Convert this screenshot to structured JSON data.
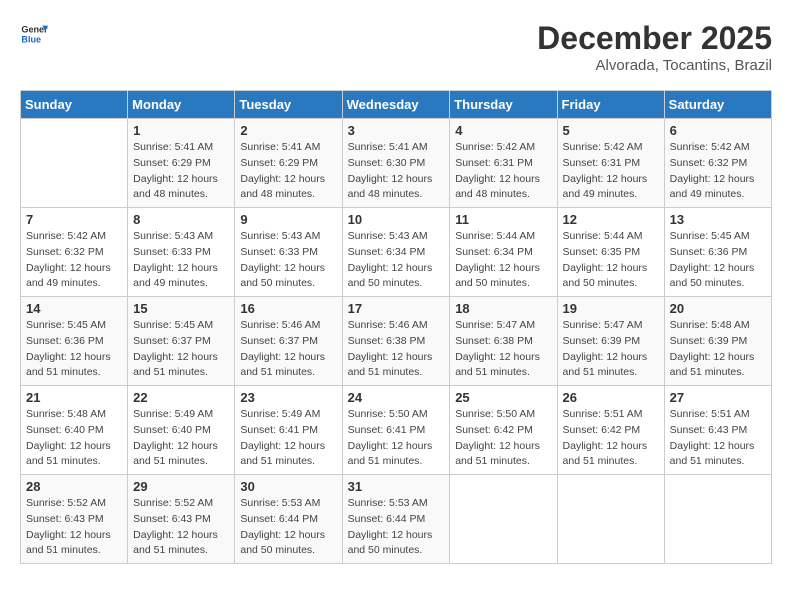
{
  "logo": {
    "line1": "General",
    "line2": "Blue"
  },
  "title": "December 2025",
  "subtitle": "Alvorada, Tocantins, Brazil",
  "days_header": [
    "Sunday",
    "Monday",
    "Tuesday",
    "Wednesday",
    "Thursday",
    "Friday",
    "Saturday"
  ],
  "weeks": [
    [
      {
        "day": "",
        "info": ""
      },
      {
        "day": "1",
        "info": "Sunrise: 5:41 AM\nSunset: 6:29 PM\nDaylight: 12 hours\nand 48 minutes."
      },
      {
        "day": "2",
        "info": "Sunrise: 5:41 AM\nSunset: 6:29 PM\nDaylight: 12 hours\nand 48 minutes."
      },
      {
        "day": "3",
        "info": "Sunrise: 5:41 AM\nSunset: 6:30 PM\nDaylight: 12 hours\nand 48 minutes."
      },
      {
        "day": "4",
        "info": "Sunrise: 5:42 AM\nSunset: 6:31 PM\nDaylight: 12 hours\nand 48 minutes."
      },
      {
        "day": "5",
        "info": "Sunrise: 5:42 AM\nSunset: 6:31 PM\nDaylight: 12 hours\nand 49 minutes."
      },
      {
        "day": "6",
        "info": "Sunrise: 5:42 AM\nSunset: 6:32 PM\nDaylight: 12 hours\nand 49 minutes."
      }
    ],
    [
      {
        "day": "7",
        "info": "Sunrise: 5:42 AM\nSunset: 6:32 PM\nDaylight: 12 hours\nand 49 minutes."
      },
      {
        "day": "8",
        "info": "Sunrise: 5:43 AM\nSunset: 6:33 PM\nDaylight: 12 hours\nand 49 minutes."
      },
      {
        "day": "9",
        "info": "Sunrise: 5:43 AM\nSunset: 6:33 PM\nDaylight: 12 hours\nand 50 minutes."
      },
      {
        "day": "10",
        "info": "Sunrise: 5:43 AM\nSunset: 6:34 PM\nDaylight: 12 hours\nand 50 minutes."
      },
      {
        "day": "11",
        "info": "Sunrise: 5:44 AM\nSunset: 6:34 PM\nDaylight: 12 hours\nand 50 minutes."
      },
      {
        "day": "12",
        "info": "Sunrise: 5:44 AM\nSunset: 6:35 PM\nDaylight: 12 hours\nand 50 minutes."
      },
      {
        "day": "13",
        "info": "Sunrise: 5:45 AM\nSunset: 6:36 PM\nDaylight: 12 hours\nand 50 minutes."
      }
    ],
    [
      {
        "day": "14",
        "info": "Sunrise: 5:45 AM\nSunset: 6:36 PM\nDaylight: 12 hours\nand 51 minutes."
      },
      {
        "day": "15",
        "info": "Sunrise: 5:45 AM\nSunset: 6:37 PM\nDaylight: 12 hours\nand 51 minutes."
      },
      {
        "day": "16",
        "info": "Sunrise: 5:46 AM\nSunset: 6:37 PM\nDaylight: 12 hours\nand 51 minutes."
      },
      {
        "day": "17",
        "info": "Sunrise: 5:46 AM\nSunset: 6:38 PM\nDaylight: 12 hours\nand 51 minutes."
      },
      {
        "day": "18",
        "info": "Sunrise: 5:47 AM\nSunset: 6:38 PM\nDaylight: 12 hours\nand 51 minutes."
      },
      {
        "day": "19",
        "info": "Sunrise: 5:47 AM\nSunset: 6:39 PM\nDaylight: 12 hours\nand 51 minutes."
      },
      {
        "day": "20",
        "info": "Sunrise: 5:48 AM\nSunset: 6:39 PM\nDaylight: 12 hours\nand 51 minutes."
      }
    ],
    [
      {
        "day": "21",
        "info": "Sunrise: 5:48 AM\nSunset: 6:40 PM\nDaylight: 12 hours\nand 51 minutes."
      },
      {
        "day": "22",
        "info": "Sunrise: 5:49 AM\nSunset: 6:40 PM\nDaylight: 12 hours\nand 51 minutes."
      },
      {
        "day": "23",
        "info": "Sunrise: 5:49 AM\nSunset: 6:41 PM\nDaylight: 12 hours\nand 51 minutes."
      },
      {
        "day": "24",
        "info": "Sunrise: 5:50 AM\nSunset: 6:41 PM\nDaylight: 12 hours\nand 51 minutes."
      },
      {
        "day": "25",
        "info": "Sunrise: 5:50 AM\nSunset: 6:42 PM\nDaylight: 12 hours\nand 51 minutes."
      },
      {
        "day": "26",
        "info": "Sunrise: 5:51 AM\nSunset: 6:42 PM\nDaylight: 12 hours\nand 51 minutes."
      },
      {
        "day": "27",
        "info": "Sunrise: 5:51 AM\nSunset: 6:43 PM\nDaylight: 12 hours\nand 51 minutes."
      }
    ],
    [
      {
        "day": "28",
        "info": "Sunrise: 5:52 AM\nSunset: 6:43 PM\nDaylight: 12 hours\nand 51 minutes."
      },
      {
        "day": "29",
        "info": "Sunrise: 5:52 AM\nSunset: 6:43 PM\nDaylight: 12 hours\nand 51 minutes."
      },
      {
        "day": "30",
        "info": "Sunrise: 5:53 AM\nSunset: 6:44 PM\nDaylight: 12 hours\nand 50 minutes."
      },
      {
        "day": "31",
        "info": "Sunrise: 5:53 AM\nSunset: 6:44 PM\nDaylight: 12 hours\nand 50 minutes."
      },
      {
        "day": "",
        "info": ""
      },
      {
        "day": "",
        "info": ""
      },
      {
        "day": "",
        "info": ""
      }
    ]
  ]
}
